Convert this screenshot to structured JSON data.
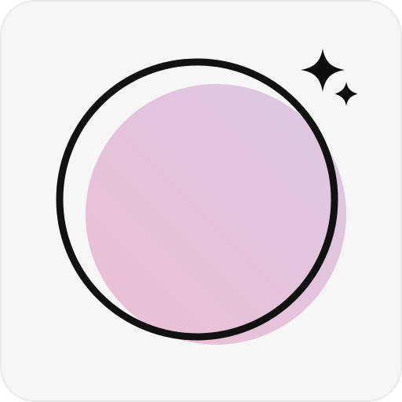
{
  "icon": {
    "name": "app-icon",
    "glyphs": [
      "ring-icon",
      "pink-disc",
      "sparkle-large-icon",
      "sparkle-small-icon"
    ]
  },
  "colors": {
    "tile_background": "#f6f6f6",
    "tile_border": "#e9e9e9",
    "ring_stroke": "#111111",
    "disc_gradient_start": "#ecbfd2",
    "disc_gradient_end": "#dcc8e4",
    "sparkle_fill": "#0d0d0d"
  }
}
